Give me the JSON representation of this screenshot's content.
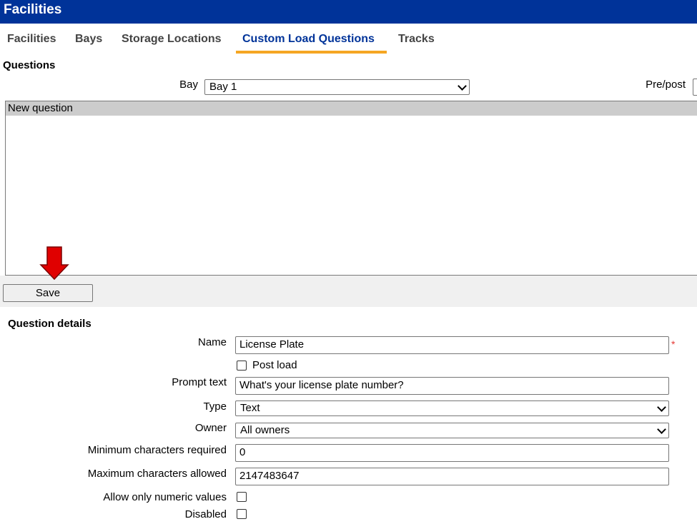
{
  "app": {
    "title": "Facilities"
  },
  "tabs": [
    {
      "label": "Facilities"
    },
    {
      "label": "Bays"
    },
    {
      "label": "Storage Locations"
    },
    {
      "label": "Custom Load Questions"
    },
    {
      "label": "Tracks"
    }
  ],
  "questions": {
    "heading": "Questions",
    "bay_label": "Bay",
    "bay_value": "Bay 1",
    "prepost_label": "Pre/post",
    "items": [
      {
        "label": "New question"
      }
    ]
  },
  "toolbar": {
    "save_label": "Save"
  },
  "details": {
    "heading": "Question details",
    "name_label": "Name",
    "name_value": "License Plate",
    "required_mark": "*",
    "post_load_label": "Post load",
    "prompt_label": "Prompt text",
    "prompt_value": "What's your license plate number?",
    "type_label": "Type",
    "type_value": "Text",
    "owner_label": "Owner",
    "owner_value": "All owners",
    "min_label": "Minimum characters required",
    "min_value": "0",
    "max_label": "Maximum characters allowed",
    "max_value": "2147483647",
    "numeric_label": "Allow only numeric values",
    "disabled_label": "Disabled"
  },
  "colors": {
    "header_bg": "#003399",
    "tab_active": "#003399",
    "tab_underline": "#f5a623",
    "arrow": "#e00000",
    "required": "#e53935"
  },
  "icons": {
    "annotation": "red-down-arrow-icon",
    "dropdown": "chevron-down-icon"
  }
}
